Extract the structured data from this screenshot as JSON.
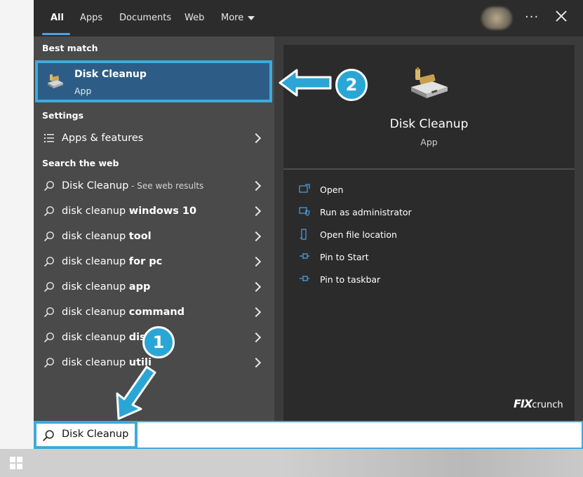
{
  "tabs": [
    "All",
    "Apps",
    "Documents",
    "Web",
    "More"
  ],
  "best_match": {
    "heading": "Best match",
    "title": "Disk Cleanup",
    "subtitle": "App"
  },
  "settings": {
    "heading": "Settings",
    "item": "Apps & features"
  },
  "web": {
    "heading": "Search the web",
    "first": {
      "text": "Disk Cleanup",
      "hint": " - See web results"
    },
    "items": [
      {
        "prefix": "disk cleanup ",
        "bold": "windows 10"
      },
      {
        "prefix": "disk cleanup ",
        "bold": "tool"
      },
      {
        "prefix": "disk cleanup ",
        "bold": "for pc"
      },
      {
        "prefix": "disk cleanup ",
        "bold": "app"
      },
      {
        "prefix": "disk cleanup ",
        "bold": "command"
      },
      {
        "prefix": "disk cleanup ",
        "bold": "disk"
      },
      {
        "prefix": "disk cleanup ",
        "bold": "utili"
      }
    ]
  },
  "preview": {
    "title": "Disk Cleanup",
    "subtitle": "App",
    "actions": [
      "Open",
      "Run as administrator",
      "Open file location",
      "Pin to Start",
      "Pin to taskbar"
    ]
  },
  "search": {
    "query": "Disk Cleanup"
  },
  "badges": [
    "1",
    "2"
  ],
  "watermark": {
    "fx": "FIX",
    "rest": "crunch"
  },
  "colors": {
    "accent": "#3fa9dd",
    "badge": "#2aa6d6",
    "selected_bg": "#2d5d86"
  }
}
